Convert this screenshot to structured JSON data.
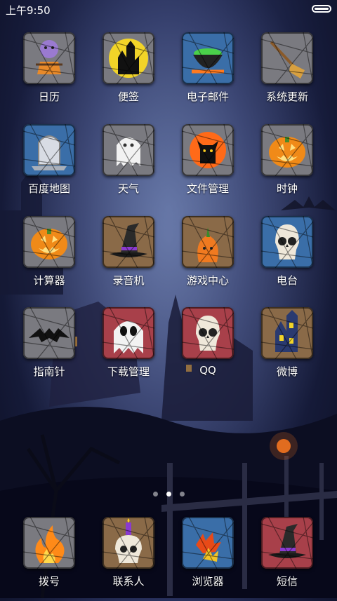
{
  "status_bar": {
    "time": "上午9:50"
  },
  "apps": [
    {
      "label": "日历",
      "icon": "scarecrow-icon",
      "bg": "#7a7a80"
    },
    {
      "label": "便签",
      "icon": "haunted-house-moon-icon",
      "bg": "#7a7a80"
    },
    {
      "label": "电子邮件",
      "icon": "cauldron-icon",
      "bg": "#3a6ea8"
    },
    {
      "label": "系统更新",
      "icon": "broom-icon",
      "bg": "#7a7a80"
    },
    {
      "label": "百度地图",
      "icon": "tombstone-icon",
      "bg": "#3a6ea8"
    },
    {
      "label": "天气",
      "icon": "ghost-icon",
      "bg": "#7a7a80"
    },
    {
      "label": "文件管理",
      "icon": "black-cat-icon",
      "bg": "#7a7a80"
    },
    {
      "label": "时钟",
      "icon": "jack-o-lantern-icon",
      "bg": "#7a7a80"
    },
    {
      "label": "计算器",
      "icon": "jack-o-lantern-icon",
      "bg": "#7a7a80"
    },
    {
      "label": "录音机",
      "icon": "witch-hat-icon",
      "bg": "#8a6a48"
    },
    {
      "label": "游戏中心",
      "icon": "pumpkin-icon",
      "bg": "#8a6a48"
    },
    {
      "label": "电台",
      "icon": "skull-icon",
      "bg": "#3a6ea8"
    },
    {
      "label": "指南针",
      "icon": "bat-icon",
      "bg": "#7a7a80"
    },
    {
      "label": "下载管理",
      "icon": "ghost-skull-icon",
      "bg": "#a8404a"
    },
    {
      "label": "QQ",
      "icon": "skull-icon",
      "bg": "#a8404a"
    },
    {
      "label": "微博",
      "icon": "haunted-house-icon",
      "bg": "#8a6a48"
    }
  ],
  "page_indicator": {
    "count": 3,
    "active": 1
  },
  "dock": [
    {
      "label": "拨号",
      "icon": "flame-icon",
      "bg": "#7a7a80"
    },
    {
      "label": "联系人",
      "icon": "skull-candle-icon",
      "bg": "#8a6a48"
    },
    {
      "label": "浏览器",
      "icon": "autumn-leaves-icon",
      "bg": "#3a6ea8"
    },
    {
      "label": "短信",
      "icon": "witch-hat-icon",
      "bg": "#a8404a"
    }
  ]
}
